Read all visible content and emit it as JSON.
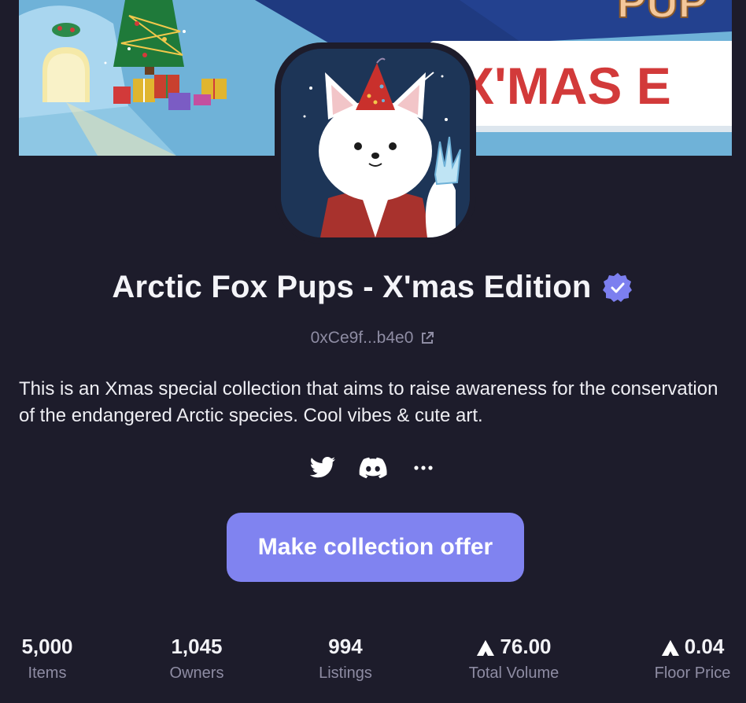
{
  "collection": {
    "name": "Arctic Fox Pups - X'mas Edition",
    "address": "0xCe9f...b4e0",
    "description": "This is an Xmas special collection that aims to raise awareness for the conservation of the endangered Arctic species. Cool vibes & cute art.",
    "banner_text_top": "PUP",
    "banner_text_main": "X'MAS E",
    "verified": true
  },
  "socials": [
    {
      "name": "twitter-icon"
    },
    {
      "name": "discord-icon"
    },
    {
      "name": "more-icon"
    }
  ],
  "actions": {
    "offer_label": "Make collection offer"
  },
  "stats": [
    {
      "value": "5,000",
      "label": "Items",
      "avax": false
    },
    {
      "value": "1,045",
      "label": "Owners",
      "avax": false
    },
    {
      "value": "994",
      "label": "Listings",
      "avax": false
    },
    {
      "value": "76.00",
      "label": "Total Volume",
      "avax": true
    },
    {
      "value": "0.04",
      "label": "Floor Price",
      "avax": true
    }
  ],
  "colors": {
    "background": "#1d1c2b",
    "accent": "#8083f0",
    "muted_text": "#8e8ca3",
    "banner_red": "#d23a3a"
  }
}
